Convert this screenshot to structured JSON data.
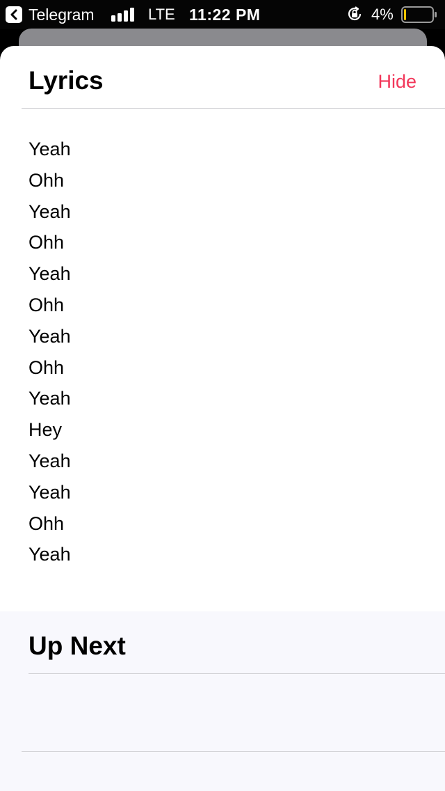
{
  "status_bar": {
    "back_app": "Telegram",
    "carrier": "LTE",
    "time": "11:22 PM",
    "battery_percent": "4%",
    "battery_level": 0.04,
    "battery_color": "#f5c400"
  },
  "lyrics": {
    "title": "Lyrics",
    "hide_label": "Hide",
    "accent_color": "#f2375a",
    "lines": [
      "Yeah",
      "Ohh",
      "Yeah",
      "Ohh",
      "Yeah",
      "Ohh",
      "Yeah",
      "Ohh",
      "Yeah",
      "Hey",
      "Yeah",
      "Yeah",
      "Ohh",
      "Yeah"
    ]
  },
  "up_next": {
    "title": "Up Next"
  }
}
